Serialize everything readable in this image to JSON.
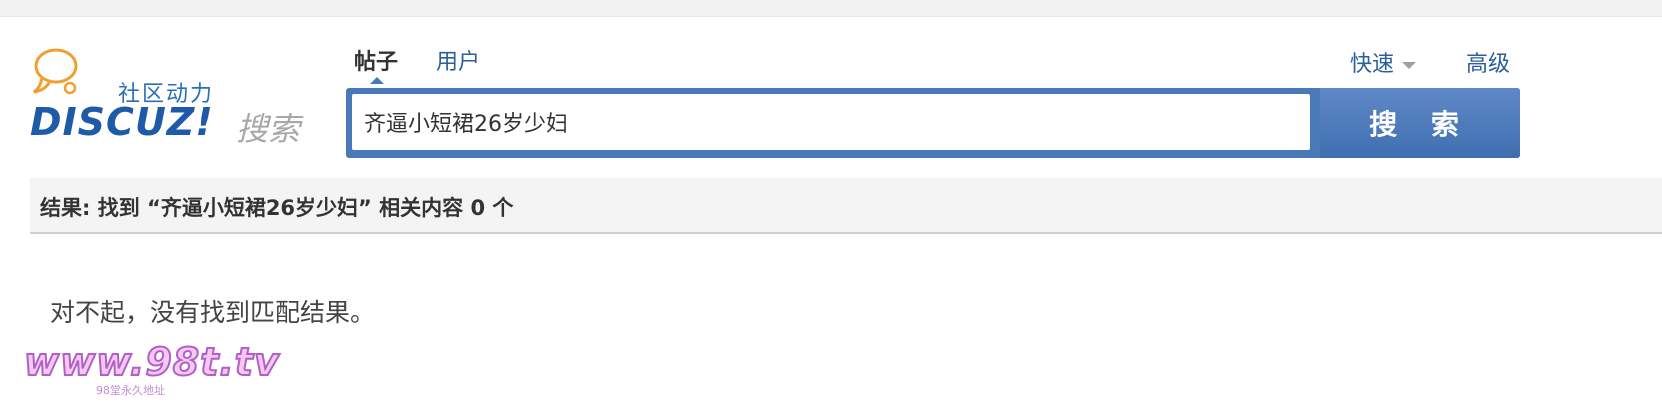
{
  "logo": {
    "subtitle": "社区动力",
    "brand": "DISCUZ!",
    "search_word": "搜索"
  },
  "tabs": [
    {
      "label": "帖子",
      "active": true
    },
    {
      "label": "用户",
      "active": false
    }
  ],
  "links": {
    "quick": "快速",
    "advanced": "高级"
  },
  "search": {
    "value": "齐逼小短裙26岁少妇",
    "button_label": "搜 索"
  },
  "result": {
    "summary": "结果: 找到 “齐逼小短裙26岁少妇” 相关内容 0 个",
    "empty_message": "对不起，没有找到匹配结果。"
  },
  "watermark": {
    "main": "www.98t.tv",
    "sub": "98堂永久地址"
  },
  "colors": {
    "accent": "#4a79b8",
    "link": "#2a5e9c",
    "result_bg": "#f4f4f4"
  }
}
